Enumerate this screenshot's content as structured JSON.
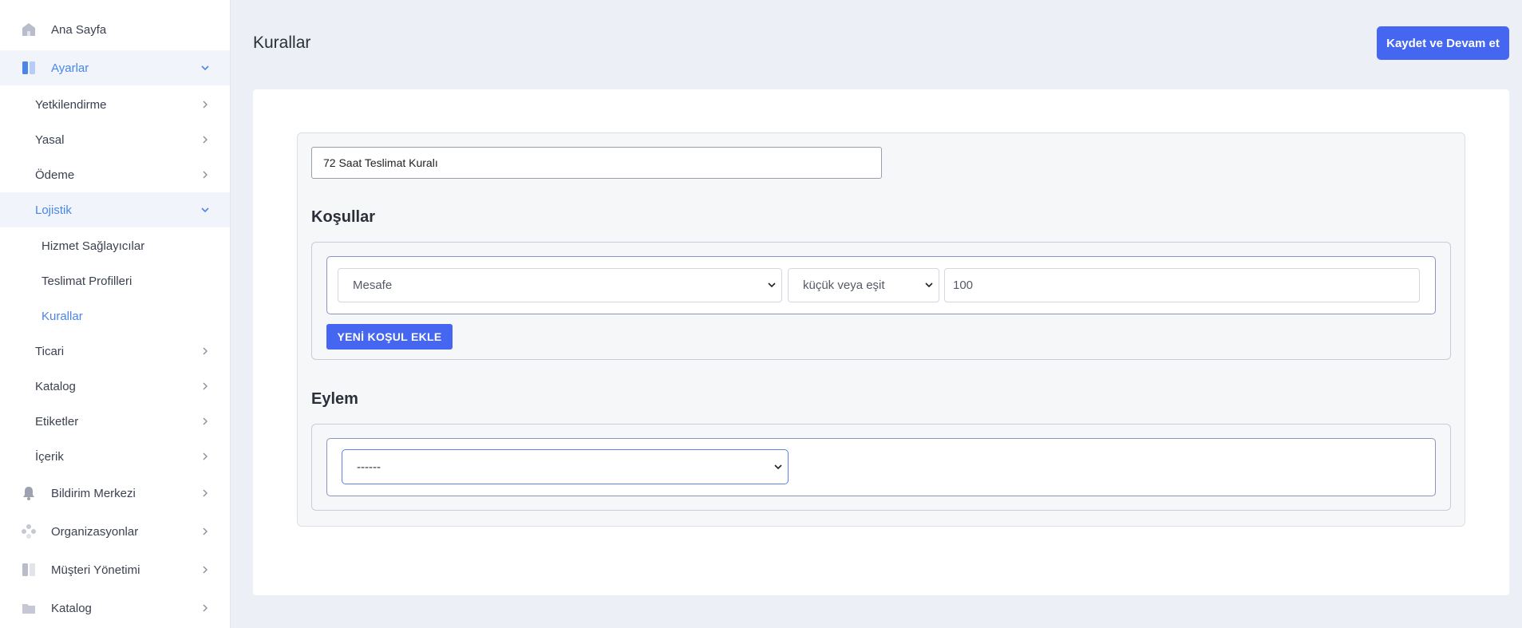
{
  "sidebar": {
    "items": [
      {
        "label": "Ana Sayfa",
        "icon": "home-icon"
      },
      {
        "label": "Ayarlar",
        "icon": "settings-panel-icon"
      },
      {
        "label": "Yetkilendirme"
      },
      {
        "label": "Yasal"
      },
      {
        "label": "Ödeme"
      },
      {
        "label": "Lojistik"
      },
      {
        "label": "Hizmet Sağlayıcılar"
      },
      {
        "label": "Teslimat Profilleri"
      },
      {
        "label": "Kurallar"
      },
      {
        "label": "Ticari"
      },
      {
        "label": "Katalog"
      },
      {
        "label": "Etiketler"
      },
      {
        "label": "İçerik"
      },
      {
        "label": "Bildirim Merkezi",
        "icon": "bell-icon"
      },
      {
        "label": "Organizasyonlar",
        "icon": "organization-icon"
      },
      {
        "label": "Müşteri Yönetimi",
        "icon": "customer-icon"
      },
      {
        "label": "Katalog",
        "icon": "folder-icon"
      }
    ]
  },
  "header": {
    "title": "Kurallar",
    "save_label": "Kaydet ve Devam et"
  },
  "form": {
    "rule_name": "72 Saat Teslimat Kuralı",
    "conditions_title": "Koşullar",
    "condition": {
      "field": "Mesafe",
      "operator": "küçük veya eşit",
      "value": "100"
    },
    "add_condition_label": "YENİ KOŞUL EKLE",
    "action_title": "Eylem",
    "action_value": "------"
  },
  "colors": {
    "accent": "#4566f0",
    "active_link": "#4a86e8",
    "background": "#eceff6"
  }
}
